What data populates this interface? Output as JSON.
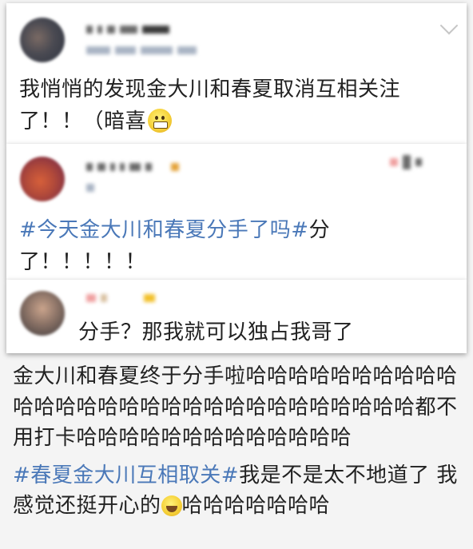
{
  "post": {
    "text_before_emoji": "我悄悄的发现金大川和春夏取消互相关注了！！（暗喜",
    "emoji_icon": "grimacing-face-icon"
  },
  "comments": [
    {
      "hashtag": "#今天金大川和春夏分手了吗#",
      "text": "分了！！！！！"
    },
    {
      "text": "分手？那我就可以独占我哥了"
    }
  ],
  "lower": {
    "paragraph1": "金大川和春夏终于分手啦哈哈哈哈哈哈哈哈哈哈哈哈哈哈哈哈哈哈哈哈哈哈哈哈哈哈哈哈哈都不用打卡哈哈哈哈哈哈哈哈哈哈哈哈哈",
    "hashtag": "#春夏金大川互相取关#",
    "paragraph2_text": "我是不是太不地道了 我感觉还挺开心的",
    "paragraph2_after_emoji": "哈哈哈哈哈哈哈",
    "emoji_icon": "laughing-face-icon"
  },
  "colors": {
    "hashtag": "#4a78b8",
    "text": "#222222",
    "background": "#f4f4f4"
  }
}
